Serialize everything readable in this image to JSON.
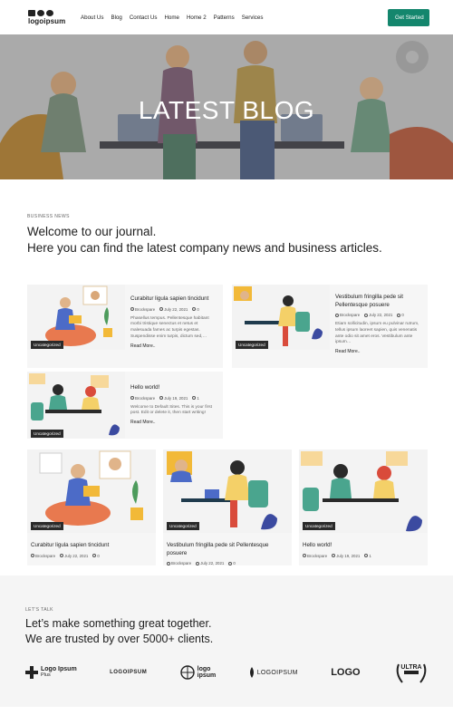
{
  "header": {
    "logo_text": "logoipsum",
    "nav": [
      "About Us",
      "Blog",
      "Contact Us",
      "Home",
      "Home 2",
      "Patterns",
      "Services"
    ],
    "cta_label": "Get Started",
    "accent_color": "#14866d"
  },
  "hero": {
    "title": "LATEST BLOG"
  },
  "intro": {
    "eyebrow": "BUSINESS NEWS",
    "line1": "Welcome to our journal.",
    "line2": "Here you can find the latest company news and business articles."
  },
  "posts": [
    {
      "category": "Uncategorized",
      "title": "Curabitur ligula sapien tincidunt",
      "author": "Brockspare",
      "date": "July 22, 2021",
      "comments": "0",
      "excerpt": "Phasellus tempus. Pellentesque habitant morbi tristique senectus et netus et malesuada fames ac turpis egestas. Suspendisse enim turpis, dictum sed,…",
      "read_more": "Read More.."
    },
    {
      "category": "Uncategorized",
      "title": "Vestibulum fringilla pede sit Pellentesque posuere",
      "author": "Brockspare",
      "date": "July 22, 2021",
      "comments": "0",
      "excerpt": "Etiam sollicitudin, ipsum eu pulvinar rutrum, tellus ipsum laoreet sapien, quis venenatis ante odio sit amet eros. Vestibulum ante ipsum…",
      "read_more": "Read More.."
    },
    {
      "category": "Uncategorized",
      "title": "Hello world!",
      "author": "Brockspare",
      "date": "July 19, 2021",
      "comments": "1",
      "excerpt": "Welcome to Default Sites. This is your first post. Edit or delete it, then start writing!",
      "read_more": "Read More.."
    }
  ],
  "grid": [
    {
      "category": "Uncategorized",
      "title": "Curabitur ligula sapien tincidunt",
      "author": "Brockspare",
      "date": "July 22, 2021",
      "comments": "0"
    },
    {
      "category": "Uncategorized",
      "title": "Vestibulum fringilla pede sit Pellentesque posuere",
      "author": "Brockspare",
      "date": "July 22, 2021",
      "comments": "0"
    },
    {
      "category": "Uncategorized",
      "title": "Hello world!",
      "author": "Brockspare",
      "date": "July 19, 2021",
      "comments": "1"
    }
  ],
  "talk": {
    "eyebrow": "LET'S TALK",
    "line1": "Let’s make something great together.",
    "line2": "We are trusted by over 5000+ clients."
  },
  "client_logos": [
    {
      "text": "Logo Ipsum",
      "sub": "Plus"
    },
    {
      "text": "LOGOIPSUM"
    },
    {
      "text": "logo",
      "sub": "ipsum"
    },
    {
      "text": "LOGOIPSUM"
    },
    {
      "text": "LOGO"
    },
    {
      "text": "ULTRA"
    }
  ]
}
